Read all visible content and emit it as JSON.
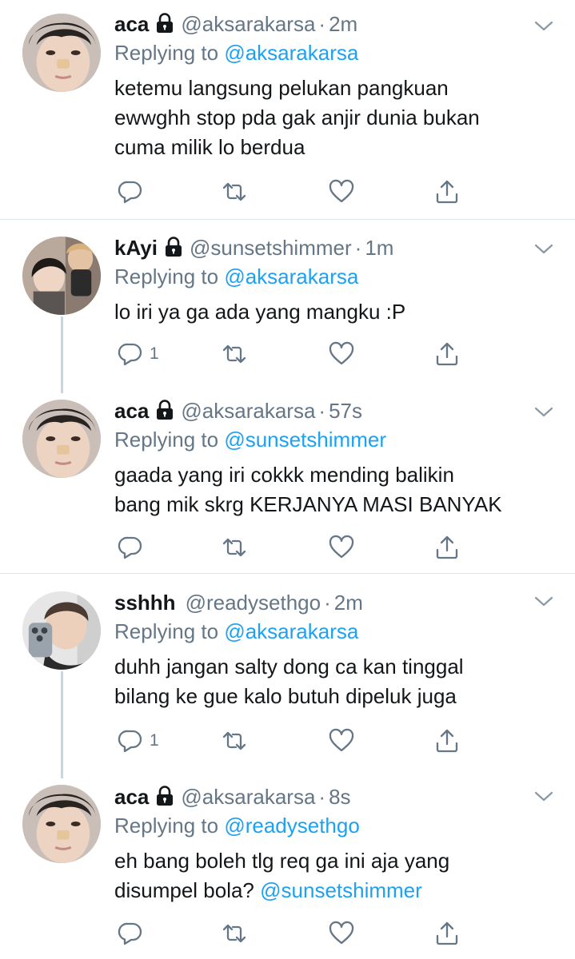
{
  "colors": {
    "text": "#14171a",
    "secondary": "#657786",
    "link": "#1da1f2",
    "divider": "#e1e8ed",
    "thread": "#cdd5dc"
  },
  "icons": {
    "lock": "lock-icon",
    "chevron": "chevron-down-icon",
    "reply": "reply-icon",
    "retweet": "retweet-icon",
    "like": "heart-icon",
    "share": "share-icon"
  },
  "tweets": [
    {
      "name": "aca",
      "handle": "@aksarakarsa",
      "time": "2m",
      "replying_label": "Replying to",
      "replying_to": "@aksarakarsa",
      "text": "ketemu langsung pelukan pangkuan\newwghh stop pda gak anjir dunia bukan\ncuma milik lo berdua",
      "reply_count": ""
    },
    {
      "name": "kAyi",
      "handle": "@sunsetshimmer",
      "time": "1m",
      "replying_label": "Replying to",
      "replying_to": "@aksarakarsa",
      "text": "lo iri ya ga ada yang mangku :P",
      "reply_count": "1"
    },
    {
      "name": "aca",
      "handle": "@aksarakarsa",
      "time": "57s",
      "replying_label": "Replying to",
      "replying_to": "@sunsetshimmer",
      "text": "gaada yang iri cokkk mending balikin\nbang mik skrg KERJANYA MASI BANYAK",
      "reply_count": ""
    },
    {
      "name": "sshhh",
      "handle": "@readysethgo",
      "time": "2m",
      "replying_label": "Replying to",
      "replying_to": "@aksarakarsa",
      "text": "duhh jangan salty dong ca kan tinggal\nbilang ke gue kalo butuh dipeluk juga",
      "reply_count": "1"
    },
    {
      "name": "aca",
      "handle": "@aksarakarsa",
      "time": "8s",
      "replying_label": "Replying to",
      "replying_to": "@readysethgo",
      "text_before": "eh bang boleh tlg req ga ini aja yang\ndisumpel bola? ",
      "text_mention": "@sunsetshimmer",
      "reply_count": ""
    }
  ]
}
